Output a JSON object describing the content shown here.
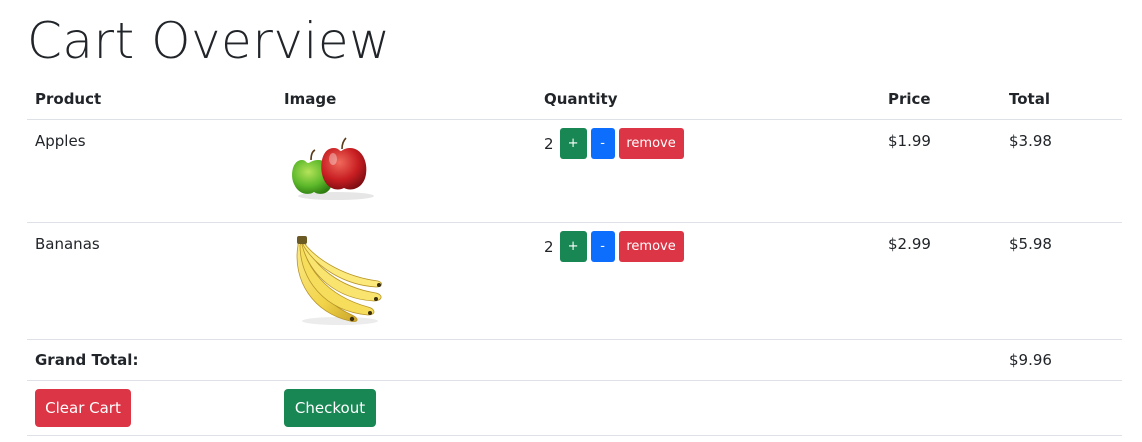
{
  "page": {
    "title": "Cart Overview"
  },
  "table": {
    "headers": {
      "product": "Product",
      "image": "Image",
      "quantity": "Quantity",
      "price": "Price",
      "total": "Total"
    },
    "rows": [
      {
        "product": "Apples",
        "image_icon": "apples-image",
        "quantity": "2",
        "plus_label": "+",
        "minus_label": "-",
        "remove_label": "remove",
        "price": "$1.99",
        "total": "$3.98"
      },
      {
        "product": "Bananas",
        "image_icon": "bananas-image",
        "quantity": "2",
        "plus_label": "+",
        "minus_label": "-",
        "remove_label": "remove",
        "price": "$2.99",
        "total": "$5.98"
      }
    ],
    "grand_total_label": "Grand Total:",
    "grand_total_value": "$9.96"
  },
  "actions": {
    "clear_label": "Clear Cart",
    "checkout_label": "Checkout"
  },
  "colors": {
    "success": "#198754",
    "primary": "#0d6efd",
    "danger": "#dc3545",
    "border": "#dee2e6",
    "text": "#212529"
  }
}
